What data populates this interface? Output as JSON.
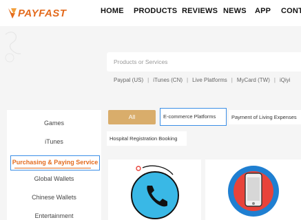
{
  "header": {
    "logo_text": "PAYFAST",
    "nav": [
      "HOME",
      "PRODUCTS",
      "REVIEWS",
      "NEWS",
      "APP",
      "CONT"
    ]
  },
  "search": {
    "placeholder": "Products or Services"
  },
  "quick_links": [
    "Paypal (US)",
    "iTunes (CN)",
    "Live Platforms",
    "MyCard (TW)",
    "iQiyi"
  ],
  "sidebar": {
    "items": [
      "Games",
      "iTunes",
      "Purchasing & Paying Service",
      "Global Wallets",
      "Chinese Wallets",
      "Entertainment"
    ]
  },
  "filters": {
    "all": "All",
    "chips": [
      "E-commerce Platforms",
      "Payment of Living Expenses",
      "Hospital Registration Booking"
    ]
  },
  "cards": [
    {
      "icon": "phone-icon"
    },
    {
      "icon": "smartphone-icon"
    }
  ],
  "colors": {
    "brand_orange": "#e36b1e",
    "gold": "#d9ad6b",
    "highlight_blue": "#3a8ee6",
    "phone_blue": "#39b8e6",
    "circle_blue": "#1f7fd1",
    "circle_red": "#e8433a"
  }
}
